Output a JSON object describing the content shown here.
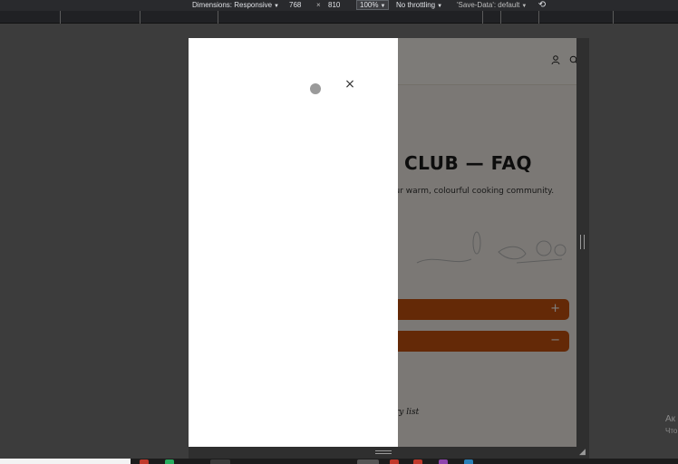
{
  "devtools": {
    "dimensions_label": "Dimensions: Responsive",
    "width": "768",
    "times": "×",
    "height": "810",
    "zoom": "100%",
    "throttling": "No throttling",
    "save_data": "'Save-Data': default",
    "rotate_icon": "rotate-icon"
  },
  "site": {
    "title": "CLUB — FAQ",
    "subtitle": "our warm, colourful cooking community.",
    "script_text": "ry list",
    "faq_items": [
      {
        "toggle": "+"
      },
      {
        "toggle": "−"
      }
    ],
    "header_icons": [
      "user-icon",
      "search-icon"
    ],
    "brand_color": "#c8530f"
  },
  "drawer": {
    "close": "×",
    "loading_icon": "spinner-icon"
  },
  "watermark": {
    "line1": "Ак",
    "line2": "Что"
  }
}
